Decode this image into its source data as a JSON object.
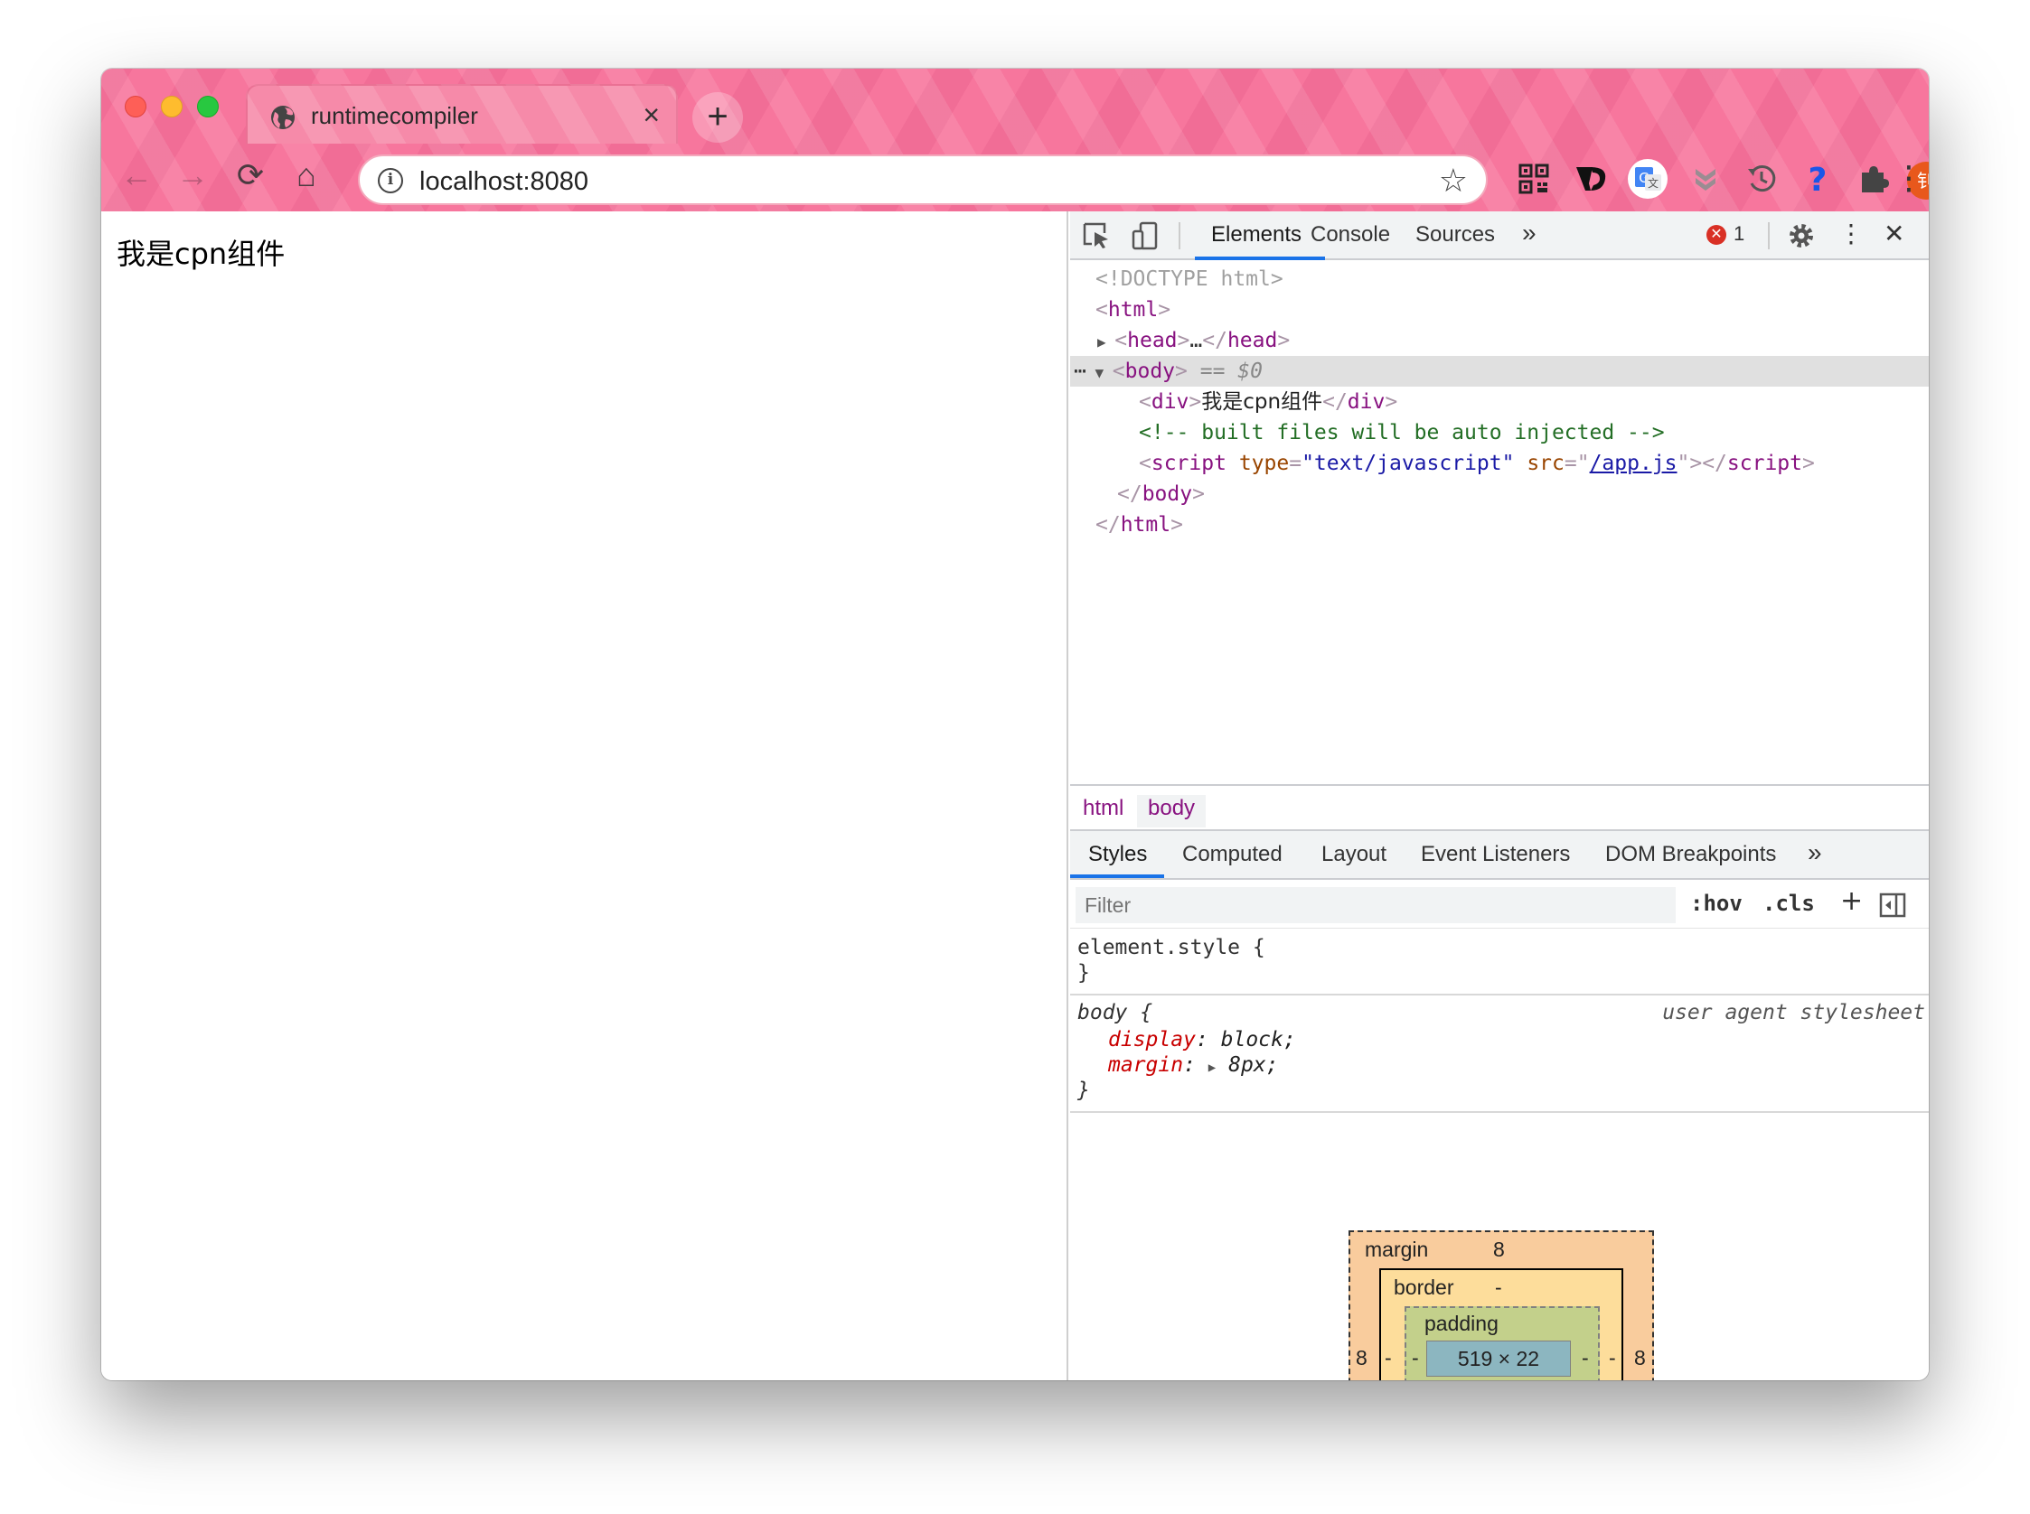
{
  "browser": {
    "tab_title": "runtimecompiler",
    "tab_close": "×",
    "new_tab": "+",
    "url": "localhost:8080",
    "back": "←",
    "forward": "→",
    "reload": "⟳",
    "home": "⌂",
    "star": "☆",
    "menu": "⋮",
    "extensions": [
      "qr-code-icon",
      "v-brand-icon",
      "translate-icon",
      "pocket-icon",
      "history-icon",
      "help-icon",
      "puzzle-icon",
      "profile-avatar"
    ],
    "avatar_text": "钊",
    "accent_color": "#f7769d"
  },
  "page": {
    "text": "我是cpn组件"
  },
  "devtools": {
    "tabs": [
      "Elements",
      "Console",
      "Sources"
    ],
    "more_tabs": "»",
    "error_count": "1",
    "close": "✕",
    "dom": {
      "doctype": "<!DOCTYPE html>",
      "html_open": "html",
      "head": "head",
      "head_ellipsis": "…",
      "body": "body",
      "body_eq": "== $0",
      "div_text": "我是cpn组件",
      "comment": "<!-- built files will be auto injected -->",
      "script_type_name": "type",
      "script_type_val": "\"text/javascript\"",
      "script_src_name": "src",
      "script_src_val": "/app.js",
      "dots": "⋯"
    },
    "breadcrumbs": [
      "html",
      "body"
    ],
    "style_tabs": [
      "Styles",
      "Computed",
      "Layout",
      "Event Listeners",
      "DOM Breakpoints"
    ],
    "style_more": "»",
    "filter_placeholder": "Filter",
    "hov": ":hov",
    "cls": ".cls",
    "add_rule": "+",
    "element_style_open": "element.style {",
    "element_style_close": "}",
    "body_rule": {
      "selector": "body",
      "brace_open": "{",
      "source": "user agent stylesheet",
      "props": [
        {
          "name": "display",
          "value": "block;"
        },
        {
          "name": "margin",
          "value": "8px;"
        }
      ],
      "brace_close": "}"
    },
    "box_model": {
      "margin_label": "margin",
      "margin_top": "8",
      "margin_left": "8",
      "margin_right": "8",
      "border_label": "border",
      "border_top": "-",
      "border_left": "-",
      "border_right": "-",
      "border_bottom": "-",
      "padding_label": "padding",
      "padding_left": "-",
      "padding_right": "-",
      "padding_bottom": "-",
      "content_size": "519 × 22"
    }
  }
}
